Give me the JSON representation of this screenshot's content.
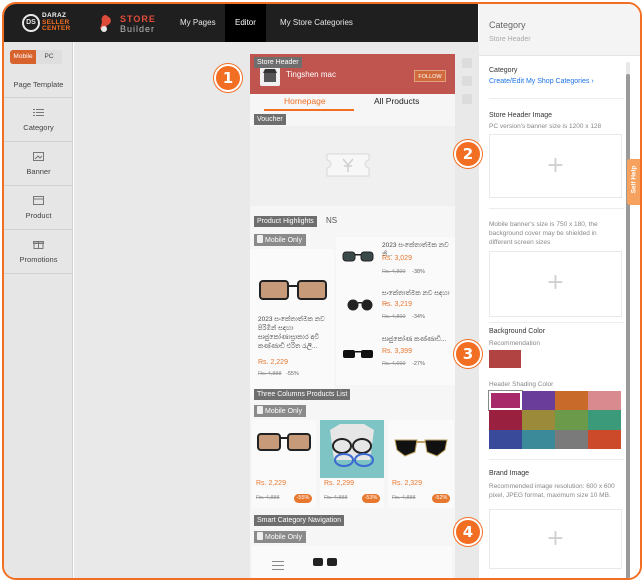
{
  "topbar": {
    "logo": {
      "circle": "DS",
      "line1": "DARAZ",
      "line2": "SELLER",
      "line3": "CENTER"
    },
    "brand": {
      "line1": "STORE",
      "line2": "Builder"
    },
    "nav": [
      "My Pages",
      "Editor",
      "My Store Categories"
    ],
    "active_nav": "Editor"
  },
  "sidebar": {
    "toggle": {
      "mobile": "Mobile",
      "pc": "PC",
      "selected": "Mobile"
    },
    "items": [
      {
        "label": "Page Template",
        "icon": "none"
      },
      {
        "label": "Category",
        "icon": "list-icon"
      },
      {
        "label": "Banner",
        "icon": "image-icon"
      },
      {
        "label": "Product",
        "icon": "box-icon"
      },
      {
        "label": "Promotions",
        "icon": "gift-icon"
      }
    ]
  },
  "canvas": {
    "store_header": {
      "tag": "Store Header",
      "store_name": "Tingshen mac",
      "follow": "FOLLOW",
      "color": "#c0544e"
    },
    "tabs": [
      "Homepage",
      "All Products"
    ],
    "voucher": {
      "tag": "Voucher"
    },
    "product_highlights": {
      "tag": "Product Highlights",
      "tag_suffix": "NS",
      "mobile_only": "Mobile Only",
      "main": {
        "title": "2023 සංකේතාත්මක නව පිරිමින් සඳහා සෘජුකෝණාස්‍රාකාර අවි කණ්ණාඩි එරිත රැලි...",
        "price": "Rs. 2,229",
        "old": "Rs. 4,888",
        "disc": "-55%"
      },
      "side": [
        {
          "title": "2023 සංකේතාත්මක නව නි...",
          "price": "Rs. 3,029",
          "old": "Rs. 4,890",
          "disc": "-38%"
        },
        {
          "title": "සංකේතාත්මක නව සඳහා ...",
          "price": "Rs. 3,219",
          "old": "Rs. 4,890",
          "disc": "-34%"
        },
        {
          "title": "සෘජුකෝණ කණ්ණාඩි...",
          "price": "Rs. 3,399",
          "old": "Rs. 4,690",
          "disc": "-27%"
        }
      ]
    },
    "three_columns": {
      "tag": "Three Columns Products List",
      "mobile_only": "Mobile Only",
      "items": [
        {
          "price": "Rs. 2,229",
          "old": "Rs. 4,888",
          "pill": "-55%"
        },
        {
          "price": "Rs. 2,299",
          "old": "Rs. 4,888",
          "pill": "-53%"
        },
        {
          "price": "Rs. 2,329",
          "old": "Rs. 4,888",
          "pill": "-52%"
        }
      ]
    },
    "smart_nav": {
      "tag": "Smart Category Navigation",
      "mobile_only": "Mobile Only"
    }
  },
  "panel": {
    "title": "Category",
    "subtitle": "Store Header",
    "category_label": "Category",
    "category_link": "Create/Edit My Shop Categories",
    "store_header_image_label": "Store Header Image",
    "pc_note": "PC version's banner size is 1200 x 128",
    "mobile_note": "Mobile banner's size is 750 x 180, the background cover may be shielded in different screen sizes",
    "background_color_label": "Background Color",
    "recommendation_label": "Recommendation",
    "background_color": "#b24343",
    "shading_label": "Header Shading Color",
    "shading_colors": [
      "#a8296a",
      "#6a3d9a",
      "#c86a2a",
      "#d98a8e",
      "#9a2040",
      "#9a8a3a",
      "#6a9a4a",
      "#3a9a7a",
      "#3a4a9a",
      "#3a8a9a",
      "#7a7a7a",
      "#cc4a2a"
    ],
    "shading_selected_index": 0,
    "brand_image_label": "Brand Image",
    "brand_note": "Recommended image resolution: 600 x 600 pixel, JPEG format, maximum size 10 MB.",
    "self_help": "Self Help",
    "upload_symbol": "+"
  },
  "callouts": [
    "1",
    "2",
    "3",
    "4"
  ]
}
